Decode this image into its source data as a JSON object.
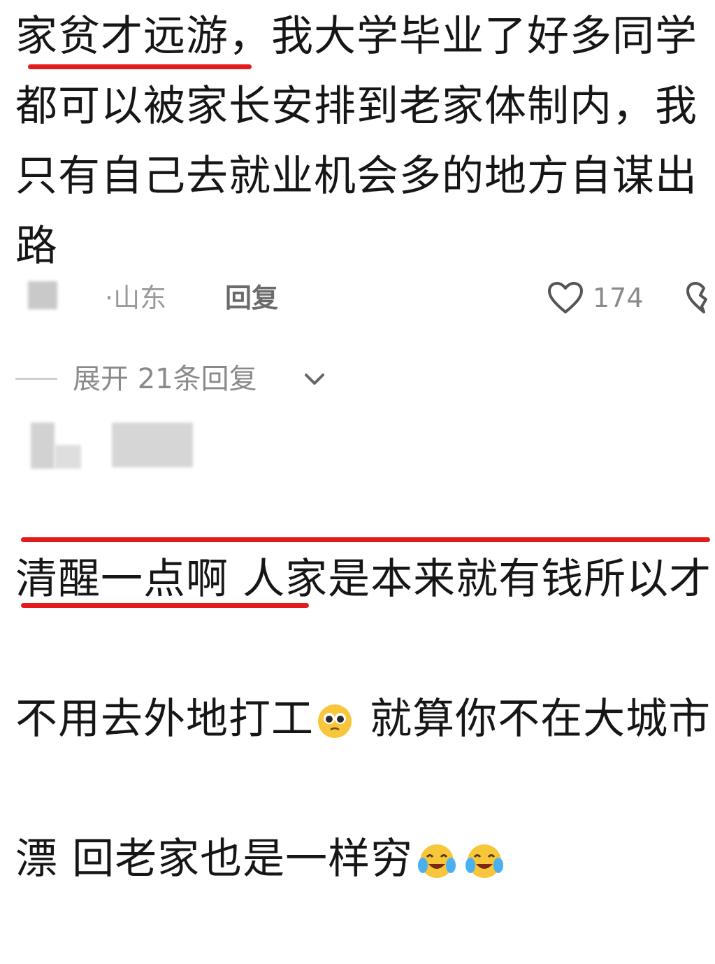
{
  "comment1": {
    "text": "家贫才远游，我大学毕业了好多同学\n都可以被家长安排到老家体制内，我\n只有自己去就业机会多的地方自谋出\n路",
    "location": "·山东",
    "reply_label": "回复",
    "like_count": "174"
  },
  "expand": {
    "label": "展开 21条回复"
  },
  "comment2": {
    "line1": "清醒一点啊 人家是本来就有钱所以才",
    "line2a": "不用去外地打工",
    "line2b": " 就算你不在大城市",
    "line3": "漂 回老家也是一样穷"
  },
  "colors": {
    "highlight": "#e41a1c",
    "muted": "#8a8a8a"
  },
  "icons": [
    "heart-outline-icon",
    "broken-heart-icon",
    "chevron-down-icon",
    "pleading-face-emoji",
    "tears-of-joy-emoji"
  ]
}
